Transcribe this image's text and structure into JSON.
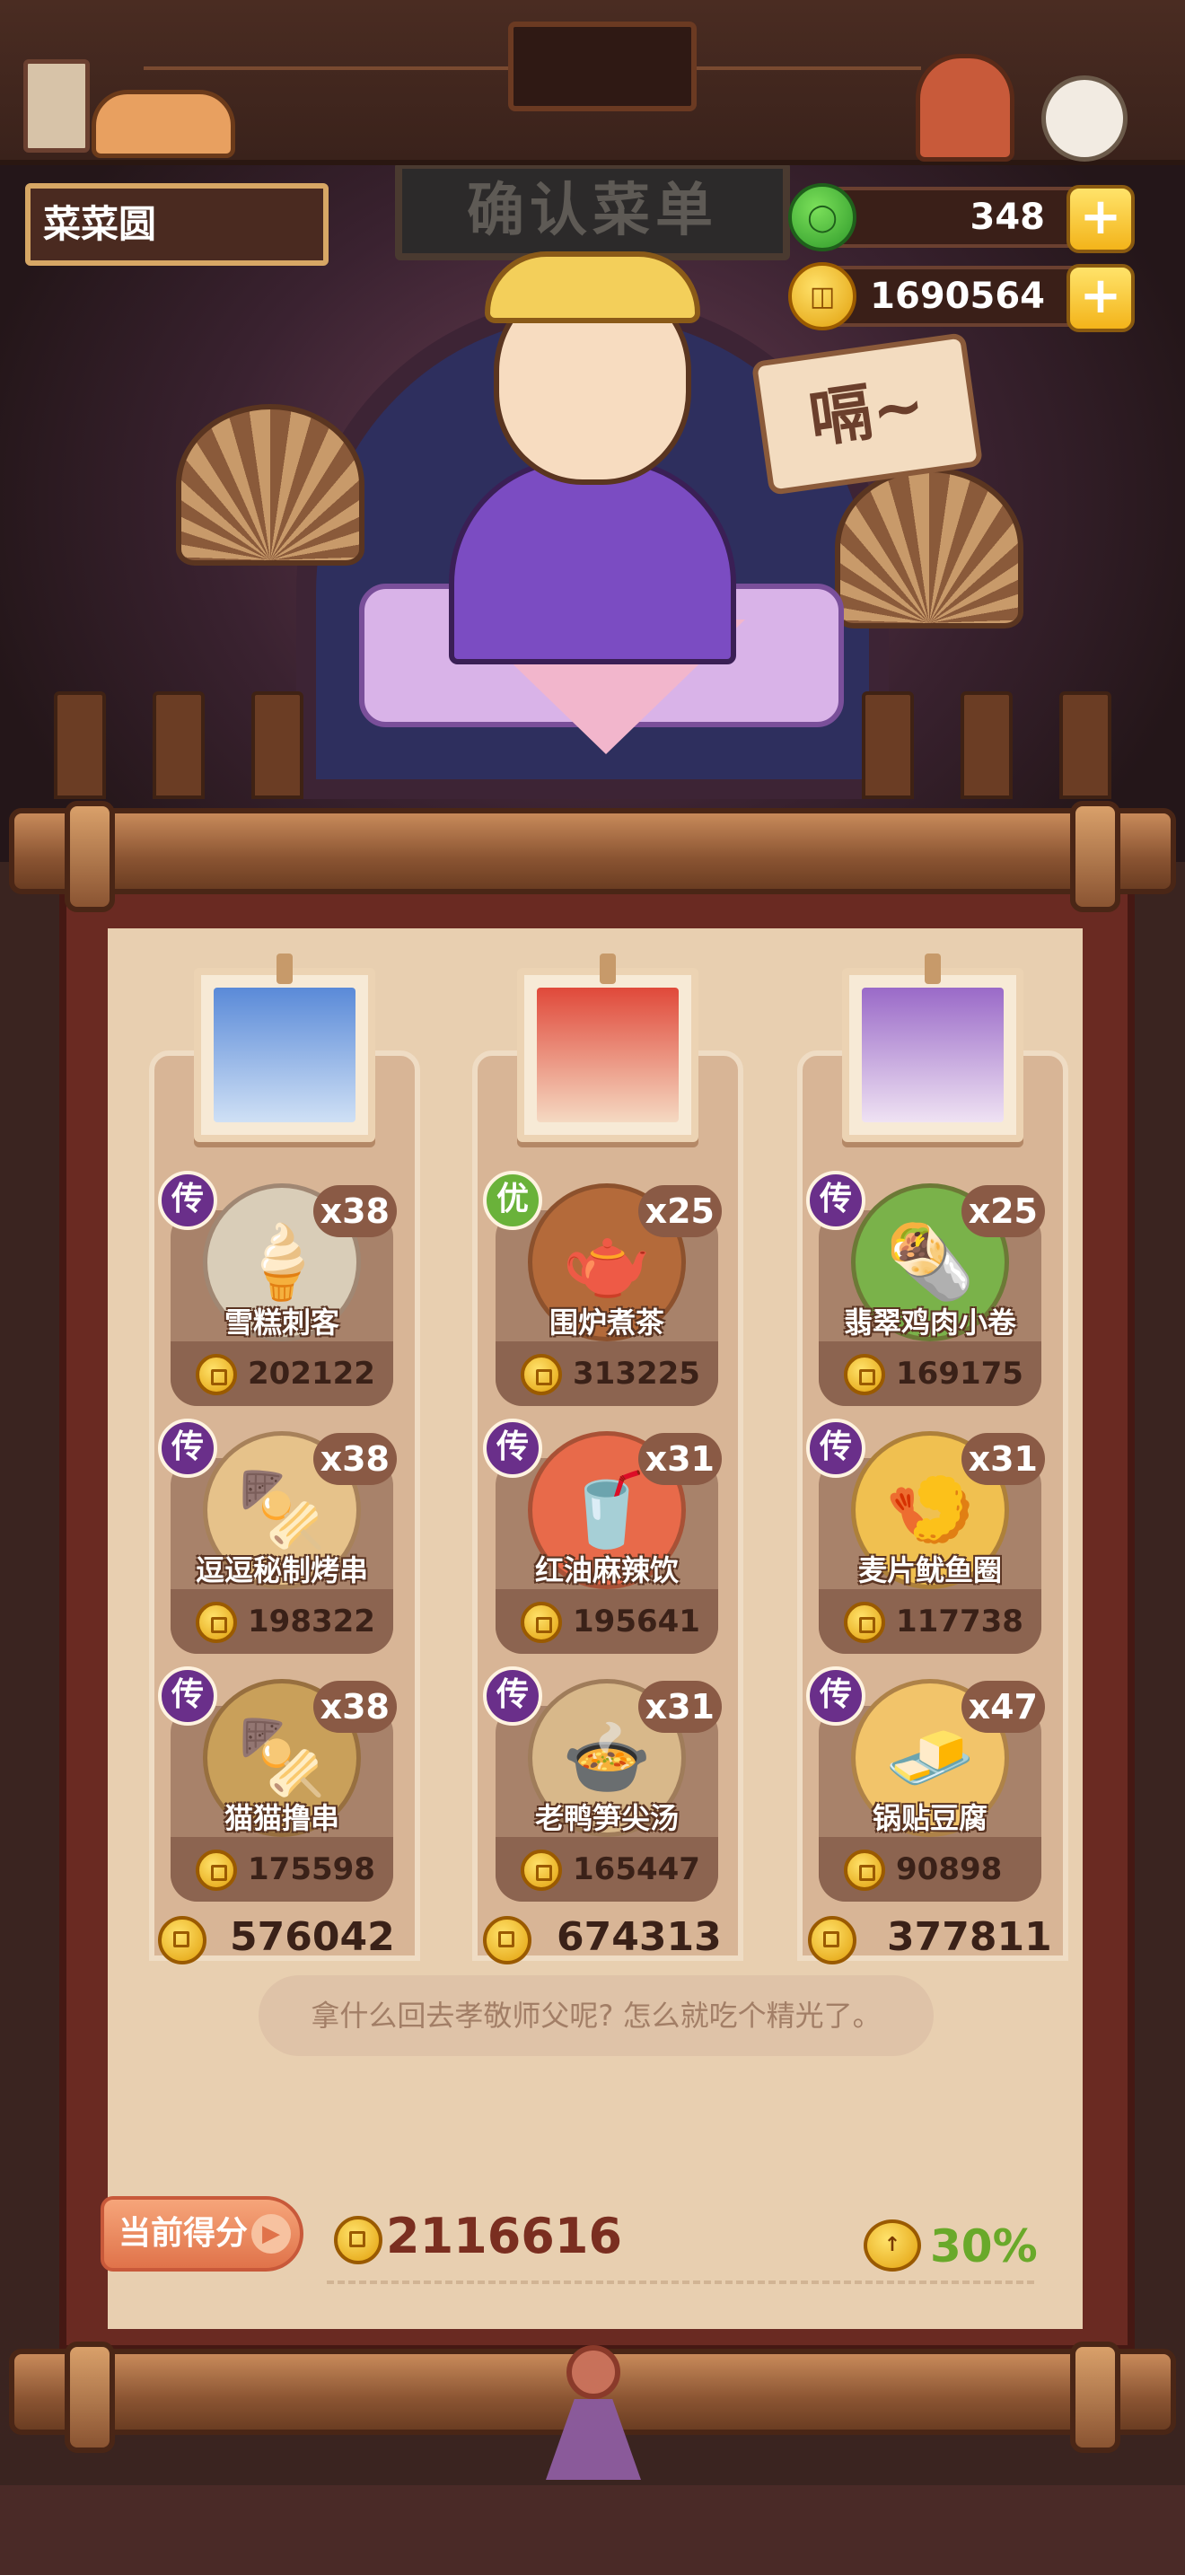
{
  "header": {
    "player_name": "菜菜圆",
    "sign_text": "确认菜单"
  },
  "currencies": [
    {
      "name": "jade",
      "amount": "348",
      "icon": "jade-icon"
    },
    {
      "name": "coin",
      "amount": "1690564",
      "icon": "coin-icon"
    }
  ],
  "customer": {
    "speech": "嗝~"
  },
  "columns": [
    {
      "total": "576042",
      "dishes": [
        {
          "name": "雪糕刺客",
          "rarity": "传",
          "qty": "x38",
          "price": "202122",
          "color": "#d9cdb8",
          "glyph": "🍦"
        },
        {
          "name": "逗逗秘制烤串",
          "rarity": "传",
          "qty": "x38",
          "price": "198322",
          "color": "#e6c28a",
          "glyph": "🍢"
        },
        {
          "name": "猫猫撸串",
          "rarity": "传",
          "qty": "x38",
          "price": "175598",
          "color": "#c9a05a",
          "glyph": "🍢"
        }
      ]
    },
    {
      "total": "674313",
      "dishes": [
        {
          "name": "围炉煮茶",
          "rarity": "优",
          "qty": "x25",
          "price": "313225",
          "color": "#b46a3a",
          "glyph": "🫖"
        },
        {
          "name": "红油麻辣饮",
          "rarity": "传",
          "qty": "x31",
          "price": "195641",
          "color": "#e86a4a",
          "glyph": "🥤"
        },
        {
          "name": "老鸭笋尖汤",
          "rarity": "传",
          "qty": "x31",
          "price": "165447",
          "color": "#d8b88a",
          "glyph": "🍲"
        }
      ]
    },
    {
      "total": "377811",
      "dishes": [
        {
          "name": "翡翠鸡肉小卷",
          "rarity": "传",
          "qty": "x25",
          "price": "169175",
          "color": "#7ab24a",
          "glyph": "🌯"
        },
        {
          "name": "麦片鱿鱼圈",
          "rarity": "传",
          "qty": "x31",
          "price": "117738",
          "color": "#f0c050",
          "glyph": "🍤"
        },
        {
          "name": "锅贴豆腐",
          "rarity": "传",
          "qty": "x47",
          "price": "90898",
          "color": "#f2c46a",
          "glyph": "🧈"
        }
      ]
    }
  ],
  "comment": "拿什么回去孝敬师父呢? 怎么就吃个精光了。",
  "score": {
    "button_label": "当前得分",
    "value": "2116616",
    "bonus": "30%"
  }
}
